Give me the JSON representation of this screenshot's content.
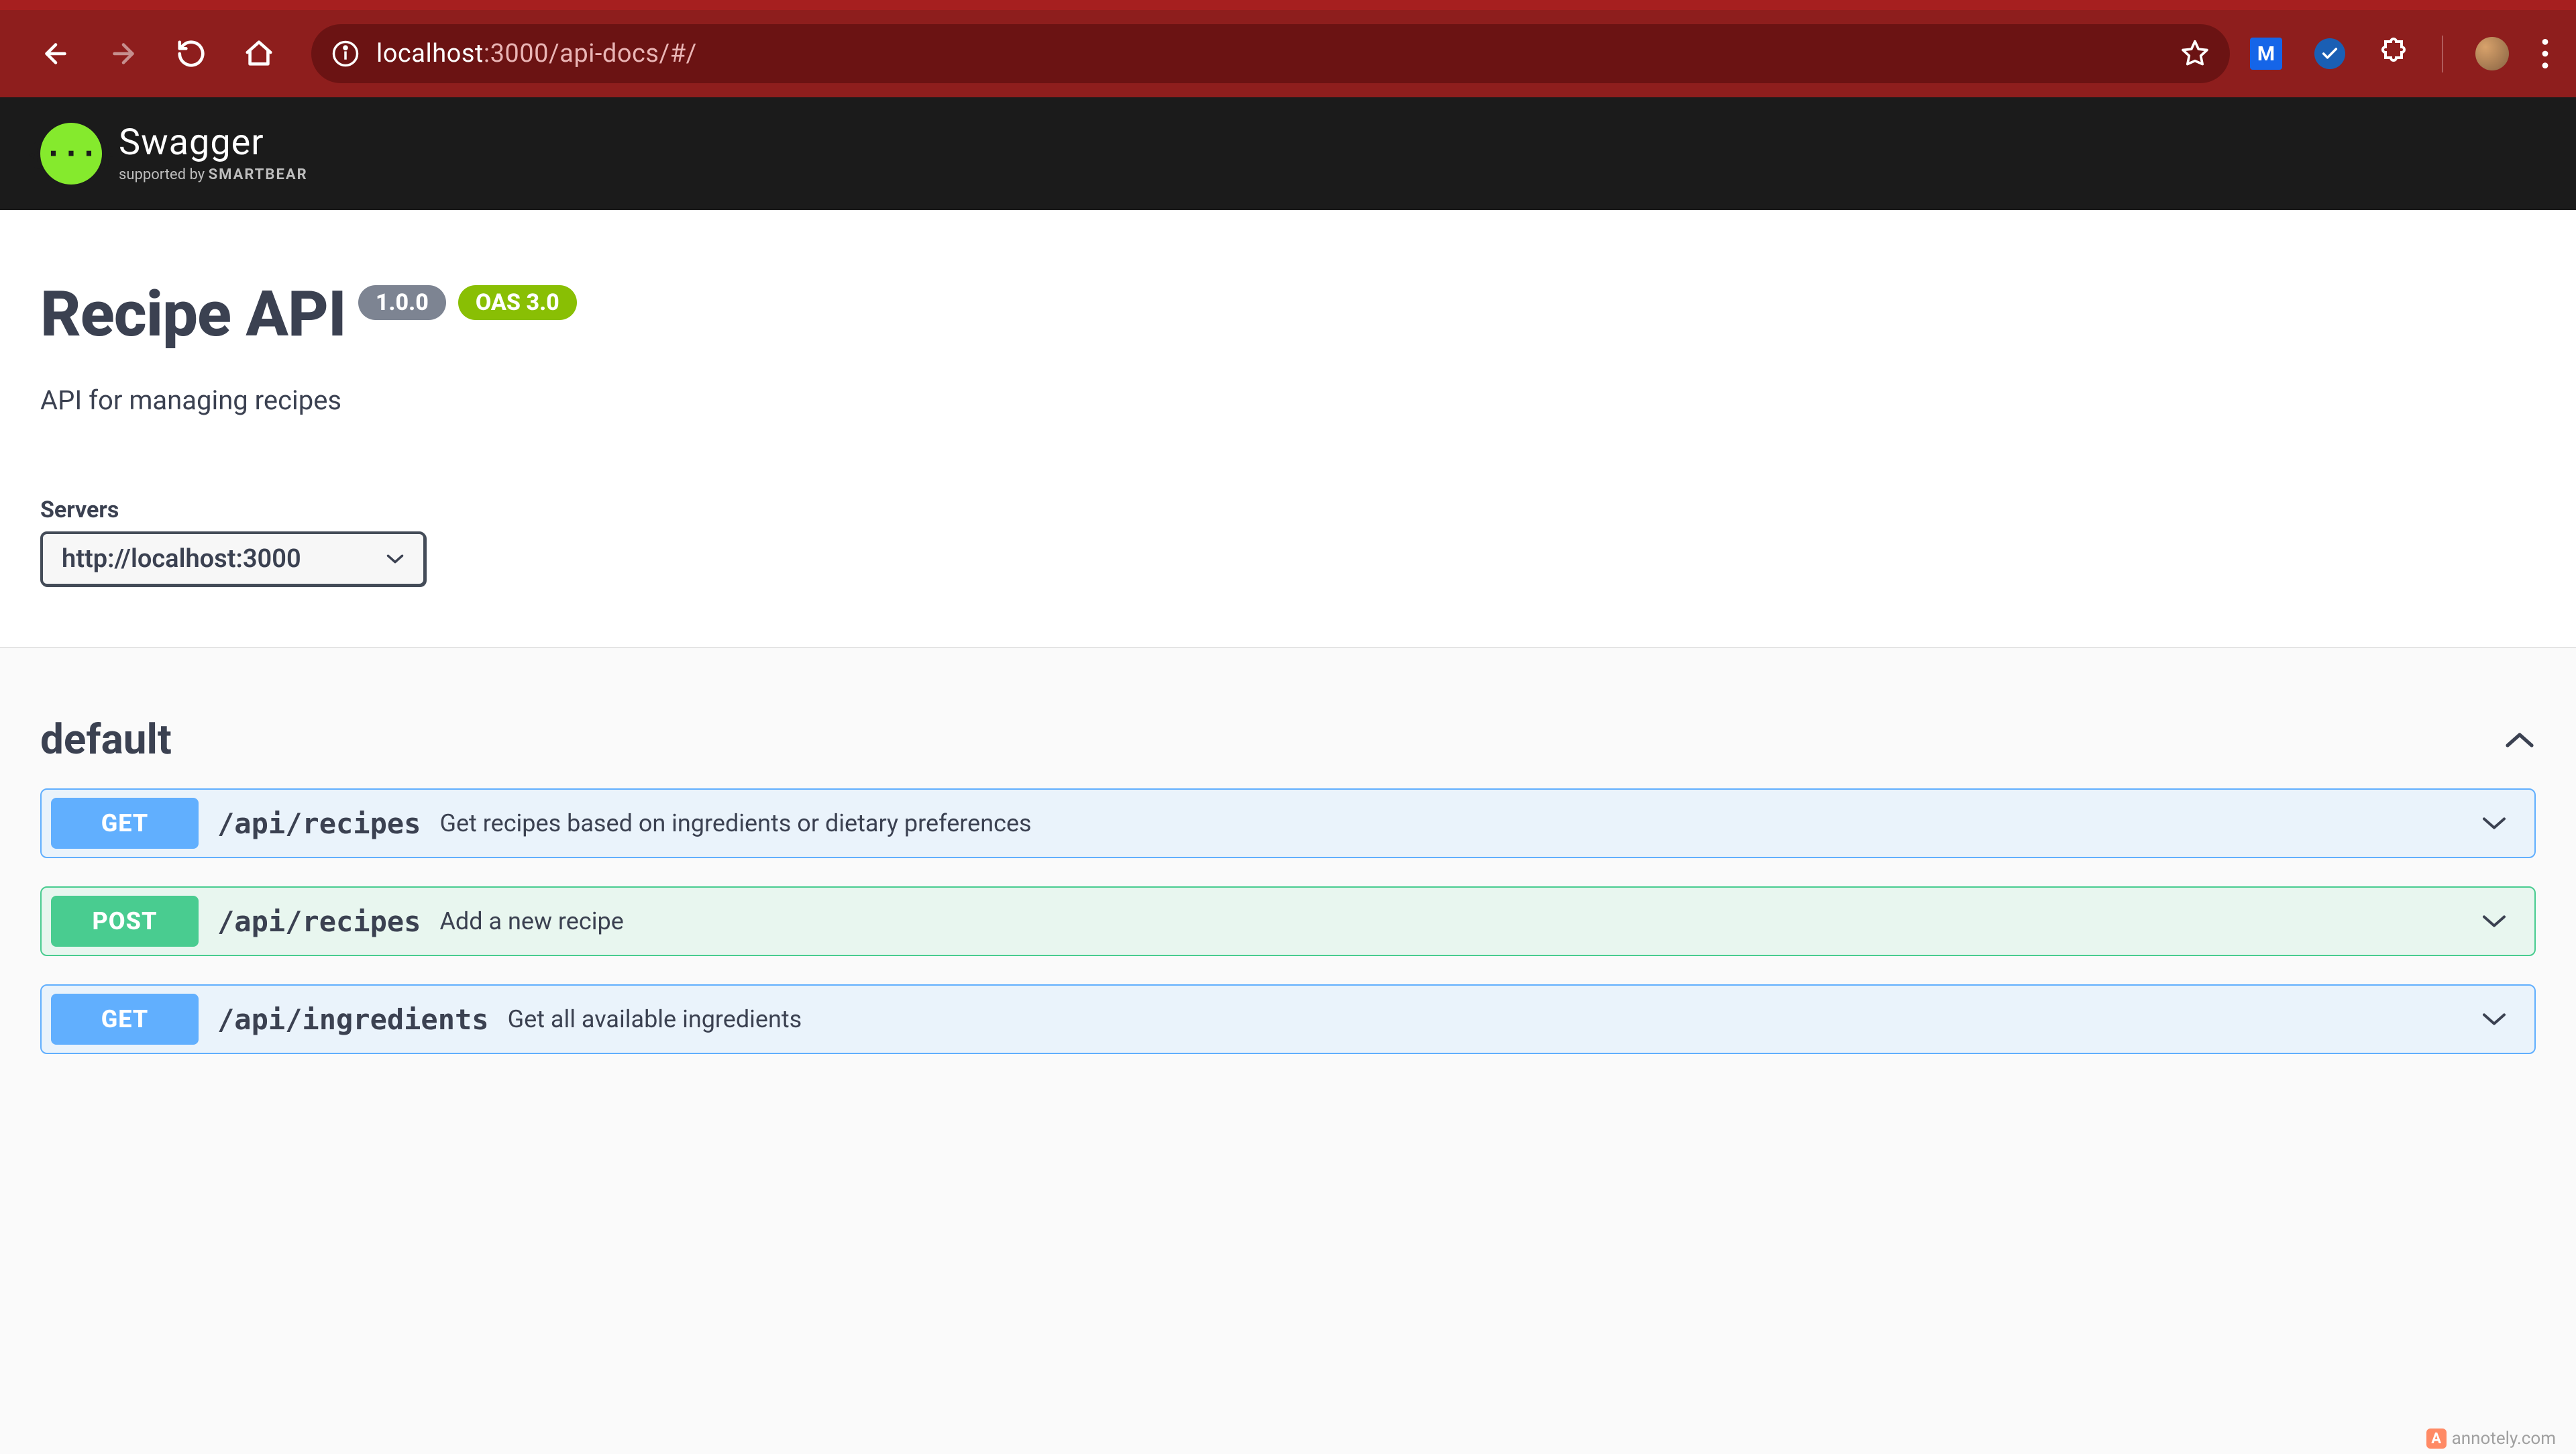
{
  "browser": {
    "url_host_prefix": "localhost",
    "url_port_path": ":3000/api-docs/#/",
    "ext_letter": "M"
  },
  "header": {
    "brand": "Swagger",
    "mark": "{···}",
    "supported": "supported by ",
    "smartbear": "SMARTBEAR"
  },
  "info": {
    "title": "Recipe API",
    "version": "1.0.0",
    "oas": "OAS 3.0",
    "description": "API for managing recipes"
  },
  "servers": {
    "label": "Servers",
    "selected": "http://localhost:3000"
  },
  "tag": "default",
  "ops": [
    {
      "method": "GET",
      "path": "/api/recipes",
      "desc": "Get recipes based on ingredients or dietary preferences",
      "kind": "get"
    },
    {
      "method": "POST",
      "path": "/api/recipes",
      "desc": "Add a new recipe",
      "kind": "post"
    },
    {
      "method": "GET",
      "path": "/api/ingredients",
      "desc": "Get all available ingredients",
      "kind": "get"
    }
  ],
  "watermark": "annotely.com"
}
